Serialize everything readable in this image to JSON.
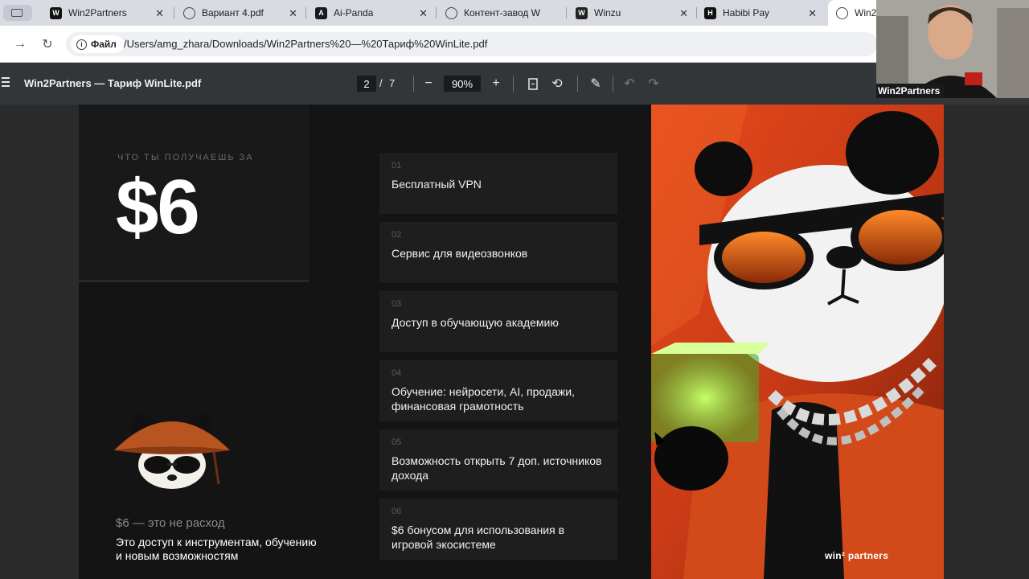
{
  "tabs": [
    {
      "title": "Win2Partners",
      "icon": "win2partners-logo-icon",
      "fav_bg": "#111111",
      "fav_text": "W"
    },
    {
      "title": "Вариант 4.pdf",
      "icon": "globe-icon"
    },
    {
      "title": "Ai-Panda",
      "icon": "ai-panda-logo-icon",
      "fav_bg": "#1a1a1a",
      "fav_text": "A"
    },
    {
      "title": "Контент-завод W",
      "icon": "globe-icon"
    },
    {
      "title": "Winzu",
      "icon": "winzu-logo-icon",
      "fav_bg": "#222222",
      "fav_text": "W"
    },
    {
      "title": "Habibi Pay",
      "icon": "habibi-pay-logo-icon",
      "fav_bg": "#111111",
      "fav_text": "H"
    },
    {
      "title": "Win2P",
      "icon": "globe-icon"
    }
  ],
  "address": {
    "chip": "Файл",
    "url": "/Users/amg_zhara/Downloads/Win2Partners%20—%20Тариф%20WinLite.pdf"
  },
  "pdf": {
    "title": "Win2Partners — Тариф WinLite.pdf",
    "page": "2",
    "slash": "/",
    "total": "7",
    "zoom": "90%"
  },
  "document": {
    "kicker": "ЧТО ТЫ ПОЛУЧАЕШЬ ЗА",
    "price": "$6",
    "subtitle": "$6 — это не расход",
    "description": "Это доступ к инструментам, обучению и новым возможностям",
    "cards": [
      {
        "num": "01",
        "text": "Бесплатный VPN"
      },
      {
        "num": "02",
        "text": "Сервис для видеозвонков"
      },
      {
        "num": "03",
        "text": "Доступ в обучающую академию"
      },
      {
        "num": "04",
        "text": "Обучение: нейросети, AI, продажи, финансовая грамотность"
      },
      {
        "num": "05",
        "text": "Возможность открыть 7 доп. источников дохода"
      },
      {
        "num": "06",
        "text": "$6 бонусом для использования в игровой экосистеме"
      }
    ],
    "watermark": "win² partners"
  },
  "webcam": {
    "label": "Win2Partners"
  },
  "colors": {
    "accent_orange": "#e5512a",
    "page_bg": "#141414",
    "card_bg": "#1e1e1e"
  }
}
